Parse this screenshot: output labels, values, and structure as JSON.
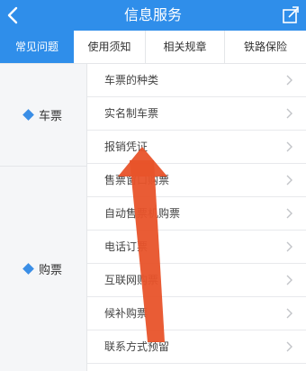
{
  "header": {
    "title": "信息服务",
    "back_icon": "back-arrow-icon",
    "share_icon": "share-icon"
  },
  "tabs": [
    {
      "label": "常见问题",
      "active": true
    },
    {
      "label": "使用须知",
      "active": false
    },
    {
      "label": "相关规章",
      "active": false
    },
    {
      "label": "铁路保险",
      "active": false
    }
  ],
  "categories": [
    {
      "label": "车票",
      "icon": "diamond-icon"
    },
    {
      "label": "购票",
      "icon": "diamond-icon"
    }
  ],
  "items": [
    {
      "label": "车票的种类"
    },
    {
      "label": "实名制车票"
    },
    {
      "label": "报销凭证"
    },
    {
      "label": "售票窗口购票"
    },
    {
      "label": "自动售票机购票"
    },
    {
      "label": "电话订票"
    },
    {
      "label": "互联网购票"
    },
    {
      "label": "候补购票"
    },
    {
      "label": "联系方式预留"
    }
  ],
  "colors": {
    "accent": "#2f8eea",
    "annotation_arrow": "#e8532a",
    "diamond": "#3a8ee6"
  }
}
